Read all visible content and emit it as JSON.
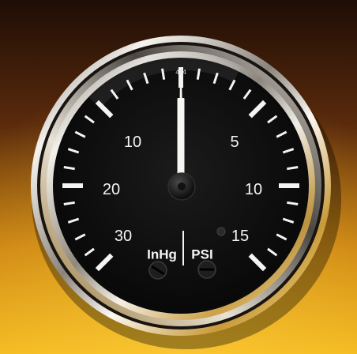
{
  "gauge": {
    "top_mark": "474",
    "vacuum_labels": [
      "10",
      "20",
      "30"
    ],
    "pressure_labels": [
      "5",
      "10",
      "15"
    ],
    "vacuum_unit": "InHg",
    "pressure_unit": "PSI",
    "needle_reading": "0"
  },
  "colors": {
    "background_top": "#2a1308",
    "background_mid": "#a85c12",
    "background_bottom": "#f0b21a",
    "bezel_chrome": "#e9e4dc",
    "dial_face": "#111111",
    "markings": "#f4f4f2"
  }
}
